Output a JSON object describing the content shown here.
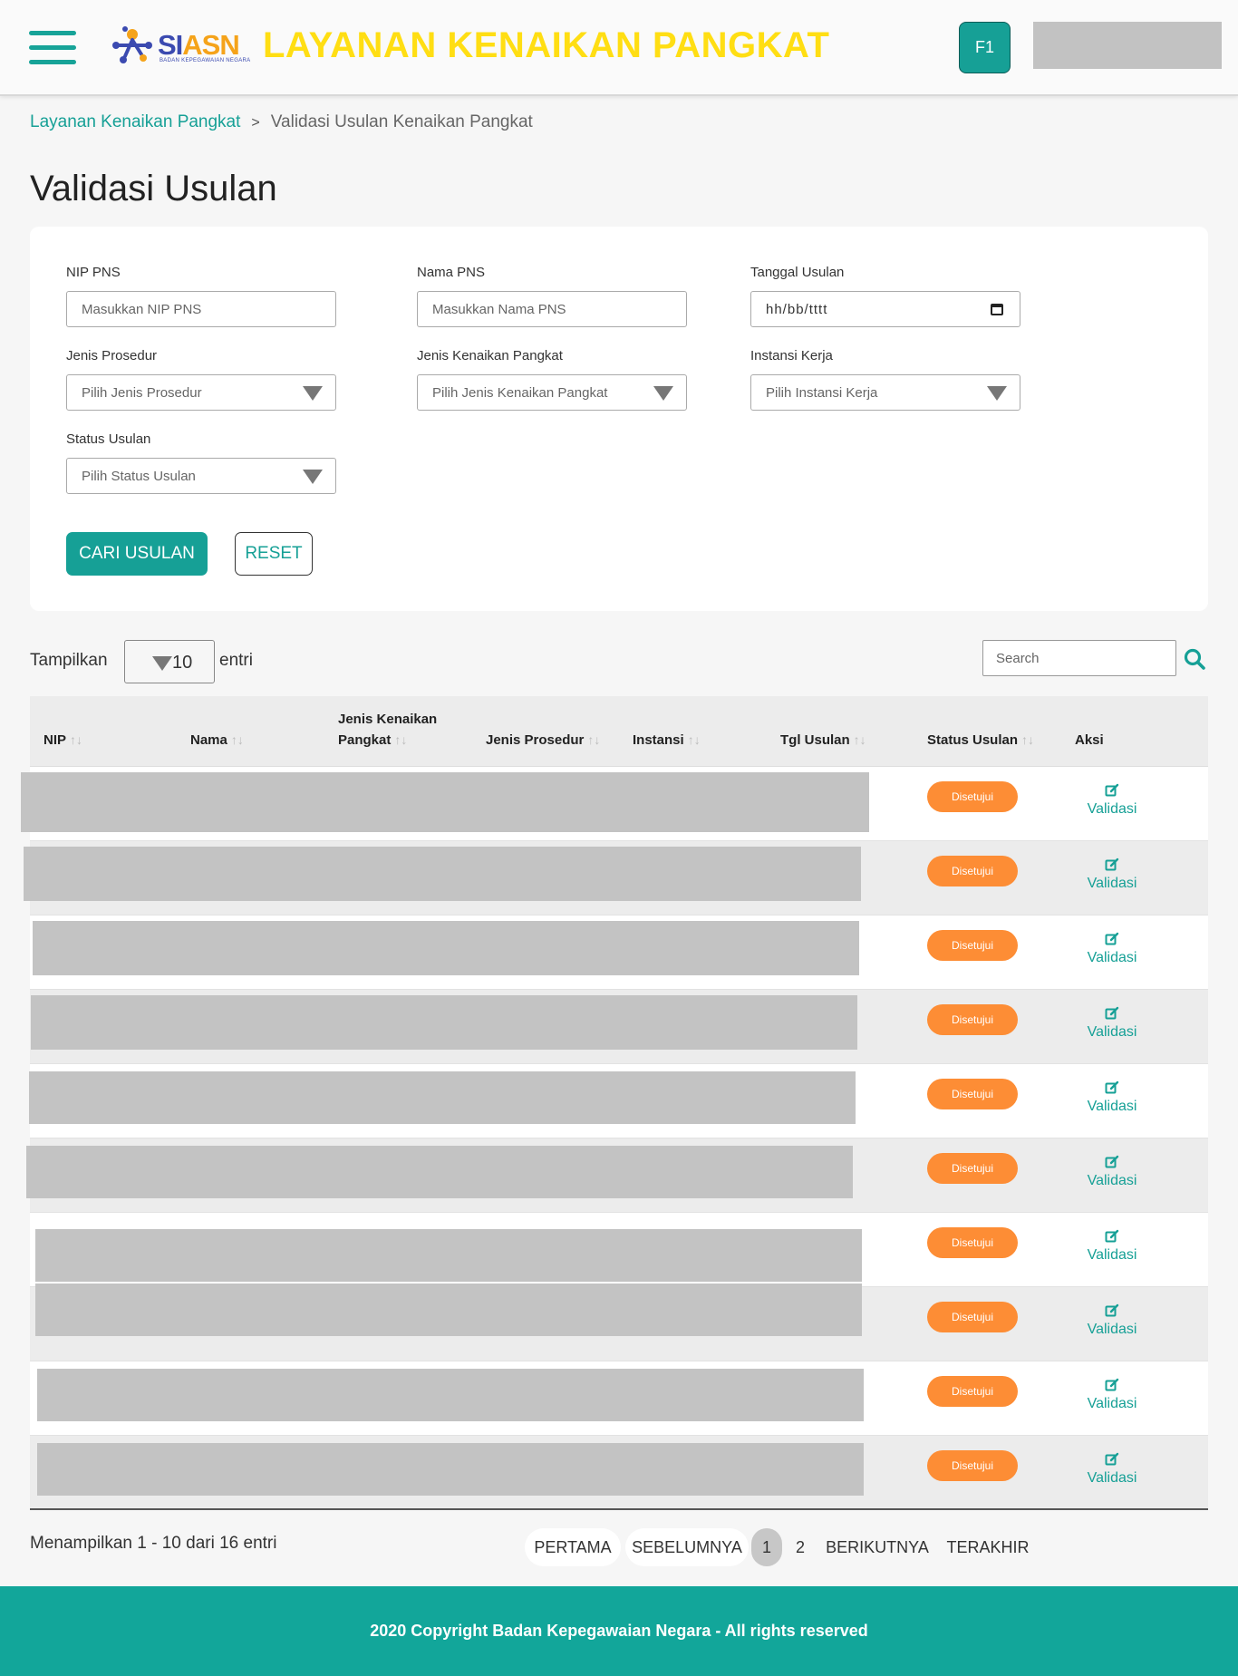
{
  "header": {
    "logo_text_main": "SI",
    "logo_text_accent": "ASN",
    "logo_subtitle": "BADAN KEPEGAWAIAN NEGARA",
    "app_title": "LAYANAN KENAIKAN PANGKAT",
    "f1_label": "F1",
    "colors": {
      "accent": "#16a096",
      "title": "#ffde13"
    }
  },
  "breadcrumb": {
    "parent": "Layanan Kenaikan Pangkat",
    "separator": ">",
    "current": "Validasi Usulan Kenaikan Pangkat"
  },
  "page_title": "Validasi Usulan",
  "filters": {
    "nip": {
      "label": "NIP PNS",
      "placeholder": "Masukkan NIP PNS"
    },
    "nama": {
      "label": "Nama PNS",
      "placeholder": "Masukkan Nama PNS"
    },
    "tanggal": {
      "label": "Tanggal Usulan",
      "value": "hh/bb/tttt"
    },
    "prosedur": {
      "label": "Jenis Prosedur",
      "value": "Pilih Jenis Prosedur"
    },
    "kenaikan": {
      "label": "Jenis Kenaikan Pangkat",
      "value": "Pilih Jenis Kenaikan Pangkat"
    },
    "instansi": {
      "label": "Instansi Kerja",
      "value": "Pilih Instansi Kerja"
    },
    "status": {
      "label": "Status Usulan",
      "value": "Pilih Status Usulan"
    },
    "search_button": "CARI USULAN",
    "reset_button": "RESET"
  },
  "table_controls": {
    "show_label": "Tampilkan",
    "page_size": "10",
    "entries_label": "entri",
    "search_placeholder": "Search"
  },
  "table": {
    "columns": [
      "NIP",
      "Nama",
      "Jenis Kenaikan",
      "Pangkat",
      "Jenis Prosedur",
      "Instansi",
      "Tgl Usulan",
      "Status Usulan",
      "Aksi"
    ],
    "sort_glyph": "↑↓",
    "rows": [
      {
        "status": "Disetujui",
        "action": "Validasi"
      },
      {
        "status": "Disetujui",
        "action": "Validasi"
      },
      {
        "status": "Disetujui",
        "action": "Validasi"
      },
      {
        "status": "Disetujui",
        "action": "Validasi"
      },
      {
        "status": "Disetujui",
        "action": "Validasi"
      },
      {
        "status": "Disetujui",
        "action": "Validasi"
      },
      {
        "status": "Disetujui",
        "action": "Validasi"
      },
      {
        "status": "Disetujui",
        "action": "Validasi"
      },
      {
        "status": "Disetujui",
        "action": "Validasi"
      },
      {
        "status": "Disetujui",
        "action": "Validasi"
      }
    ],
    "status_color": "#fd8d35"
  },
  "pagination": {
    "info": "Menampilkan 1 - 10 dari 16 entri",
    "first": "PERTAMA",
    "prev": "SEBELUMNYA",
    "pages": [
      "1",
      "2"
    ],
    "next": "BERIKUTNYA",
    "last": "TERAKHIR"
  },
  "footer": {
    "copyright": "2020 Copyright Badan Kepegawaian Negara - All rights reserved"
  }
}
